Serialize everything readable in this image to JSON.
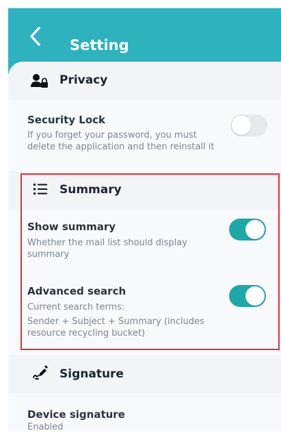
{
  "header": {
    "title": "Setting"
  },
  "privacy": {
    "title": "Privacy",
    "security_lock": {
      "title": "Security Lock",
      "description_line1": "If you forget your password, you must",
      "description_line2": "delete the application and then reinstall it",
      "enabled": false
    }
  },
  "summary": {
    "title": "Summary",
    "show_summary": {
      "title": "Show summary",
      "description_line1": "Whether the mail list should display",
      "description_line2": "summary",
      "enabled": true
    },
    "advanced_search": {
      "title": "Advanced search",
      "description_line1": "Current search terms:",
      "description_line2": "Sender + Subject + Summary (includes",
      "description_line3": "resource recycling bucket)",
      "enabled": true
    }
  },
  "signature": {
    "title": "Signature",
    "device_signature": {
      "title": "Device signature",
      "status": "Enabled"
    }
  },
  "colors": {
    "header": "#2eb2bd",
    "toggle_on": "#1fa9a6",
    "toggle_off": "#e6e8ea",
    "highlight_border": "#e0303a"
  },
  "icons": {
    "back": "chevron-left-icon",
    "privacy": "user-lock-icon",
    "summary": "list-icon",
    "signature": "pen-signature-icon"
  }
}
